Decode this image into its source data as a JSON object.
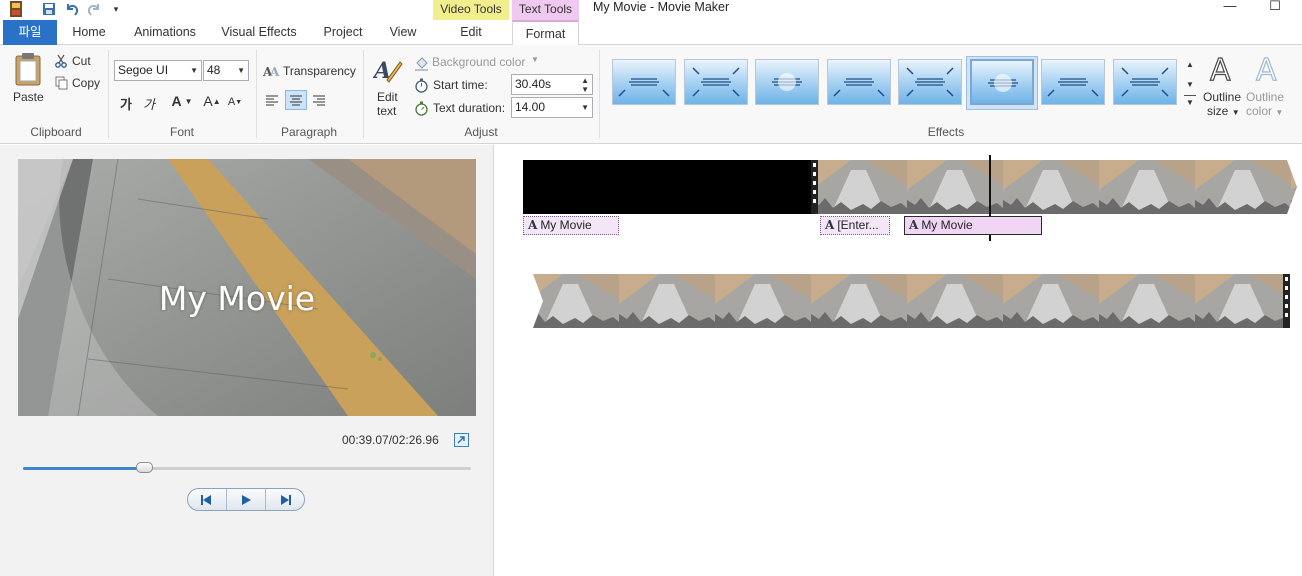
{
  "window": {
    "title": "My Movie - Movie Maker",
    "minimize": "—",
    "maximize": "☐"
  },
  "quick_access": {
    "icons": [
      "film-icon",
      "save-icon",
      "undo-icon",
      "redo-icon",
      "customize-icon"
    ]
  },
  "context_tabs": {
    "video_tools": "Video Tools",
    "text_tools": "Text Tools"
  },
  "tabs": {
    "file": "파일",
    "home": "Home",
    "animations": "Animations",
    "visual_effects": "Visual Effects",
    "project": "Project",
    "view": "View",
    "edit": "Edit",
    "format": "Format"
  },
  "ribbon": {
    "clipboard": {
      "label": "Clipboard",
      "paste": "Paste",
      "cut": "Cut",
      "copy": "Copy"
    },
    "font": {
      "label": "Font",
      "family": "Segoe UI",
      "size": "48",
      "bold_glyph": "가",
      "italic_glyph": "가",
      "color_glyph": "A",
      "grow_glyph": "A",
      "shrink_glyph": "A"
    },
    "paragraph": {
      "label": "Paragraph",
      "transparency": "Transparency"
    },
    "adjust": {
      "label": "Adjust",
      "edit_text_line1": "Edit",
      "edit_text_line2": "text",
      "background_color": "Background color",
      "start_time_label": "Start time:",
      "start_time_value": "30.40s",
      "text_duration_label": "Text duration:",
      "text_duration_value": "14.00"
    },
    "effects": {
      "label": "Effects",
      "selected_index": 5,
      "count": 8
    },
    "outline": {
      "size_line1": "Outline",
      "size_line2": "size",
      "color_line1": "Outline",
      "color_line2": "color"
    }
  },
  "preview": {
    "overlay_title": "My Movie",
    "timecode": "00:39.07/02:26.96",
    "seek_fraction": 0.27
  },
  "storyboard": {
    "captions": [
      {
        "text": "My Movie"
      },
      {
        "text": "[Enter..."
      },
      {
        "text": "My Movie"
      }
    ]
  },
  "colors": {
    "accent_blue": "#2a72c8",
    "video_tools": "#f2ee8e",
    "text_tools": "#efc9ef",
    "caption_bg": "#f3e6f6"
  }
}
